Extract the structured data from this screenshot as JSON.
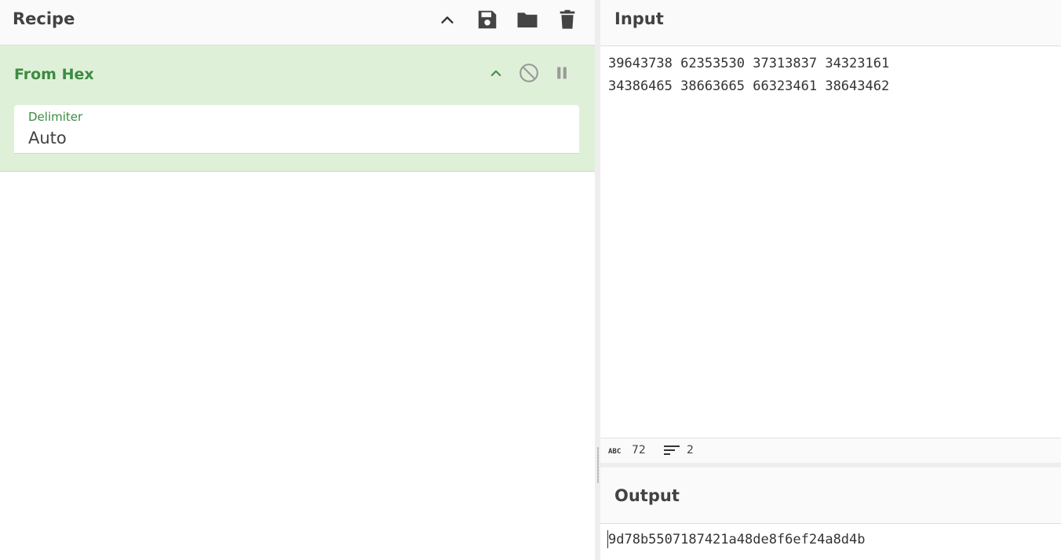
{
  "recipe": {
    "title": "Recipe",
    "operation": {
      "name": "From Hex",
      "argument": {
        "label": "Delimiter",
        "value": "Auto"
      }
    }
  },
  "input": {
    "title": "Input",
    "text": "39643738 62353530 37313837 34323161\n34386465 38663665 66323461 38643462",
    "length": "72",
    "lines": "2"
  },
  "output": {
    "title": "Output",
    "text": "9d78b5507187421a48de8f6ef24a8d4b"
  },
  "icons": {
    "recipe_header": [
      "chevron-up-icon",
      "save-icon",
      "folder-icon",
      "trash-icon"
    ],
    "operation": [
      "chevron-up-icon",
      "disable-icon",
      "pause-icon"
    ],
    "status": [
      "abc-icon",
      "lines-icon"
    ]
  },
  "colors": {
    "operation_bg": "#dff0d8",
    "operation_accent": "#3c8b42",
    "header_bg": "#fafafa"
  }
}
